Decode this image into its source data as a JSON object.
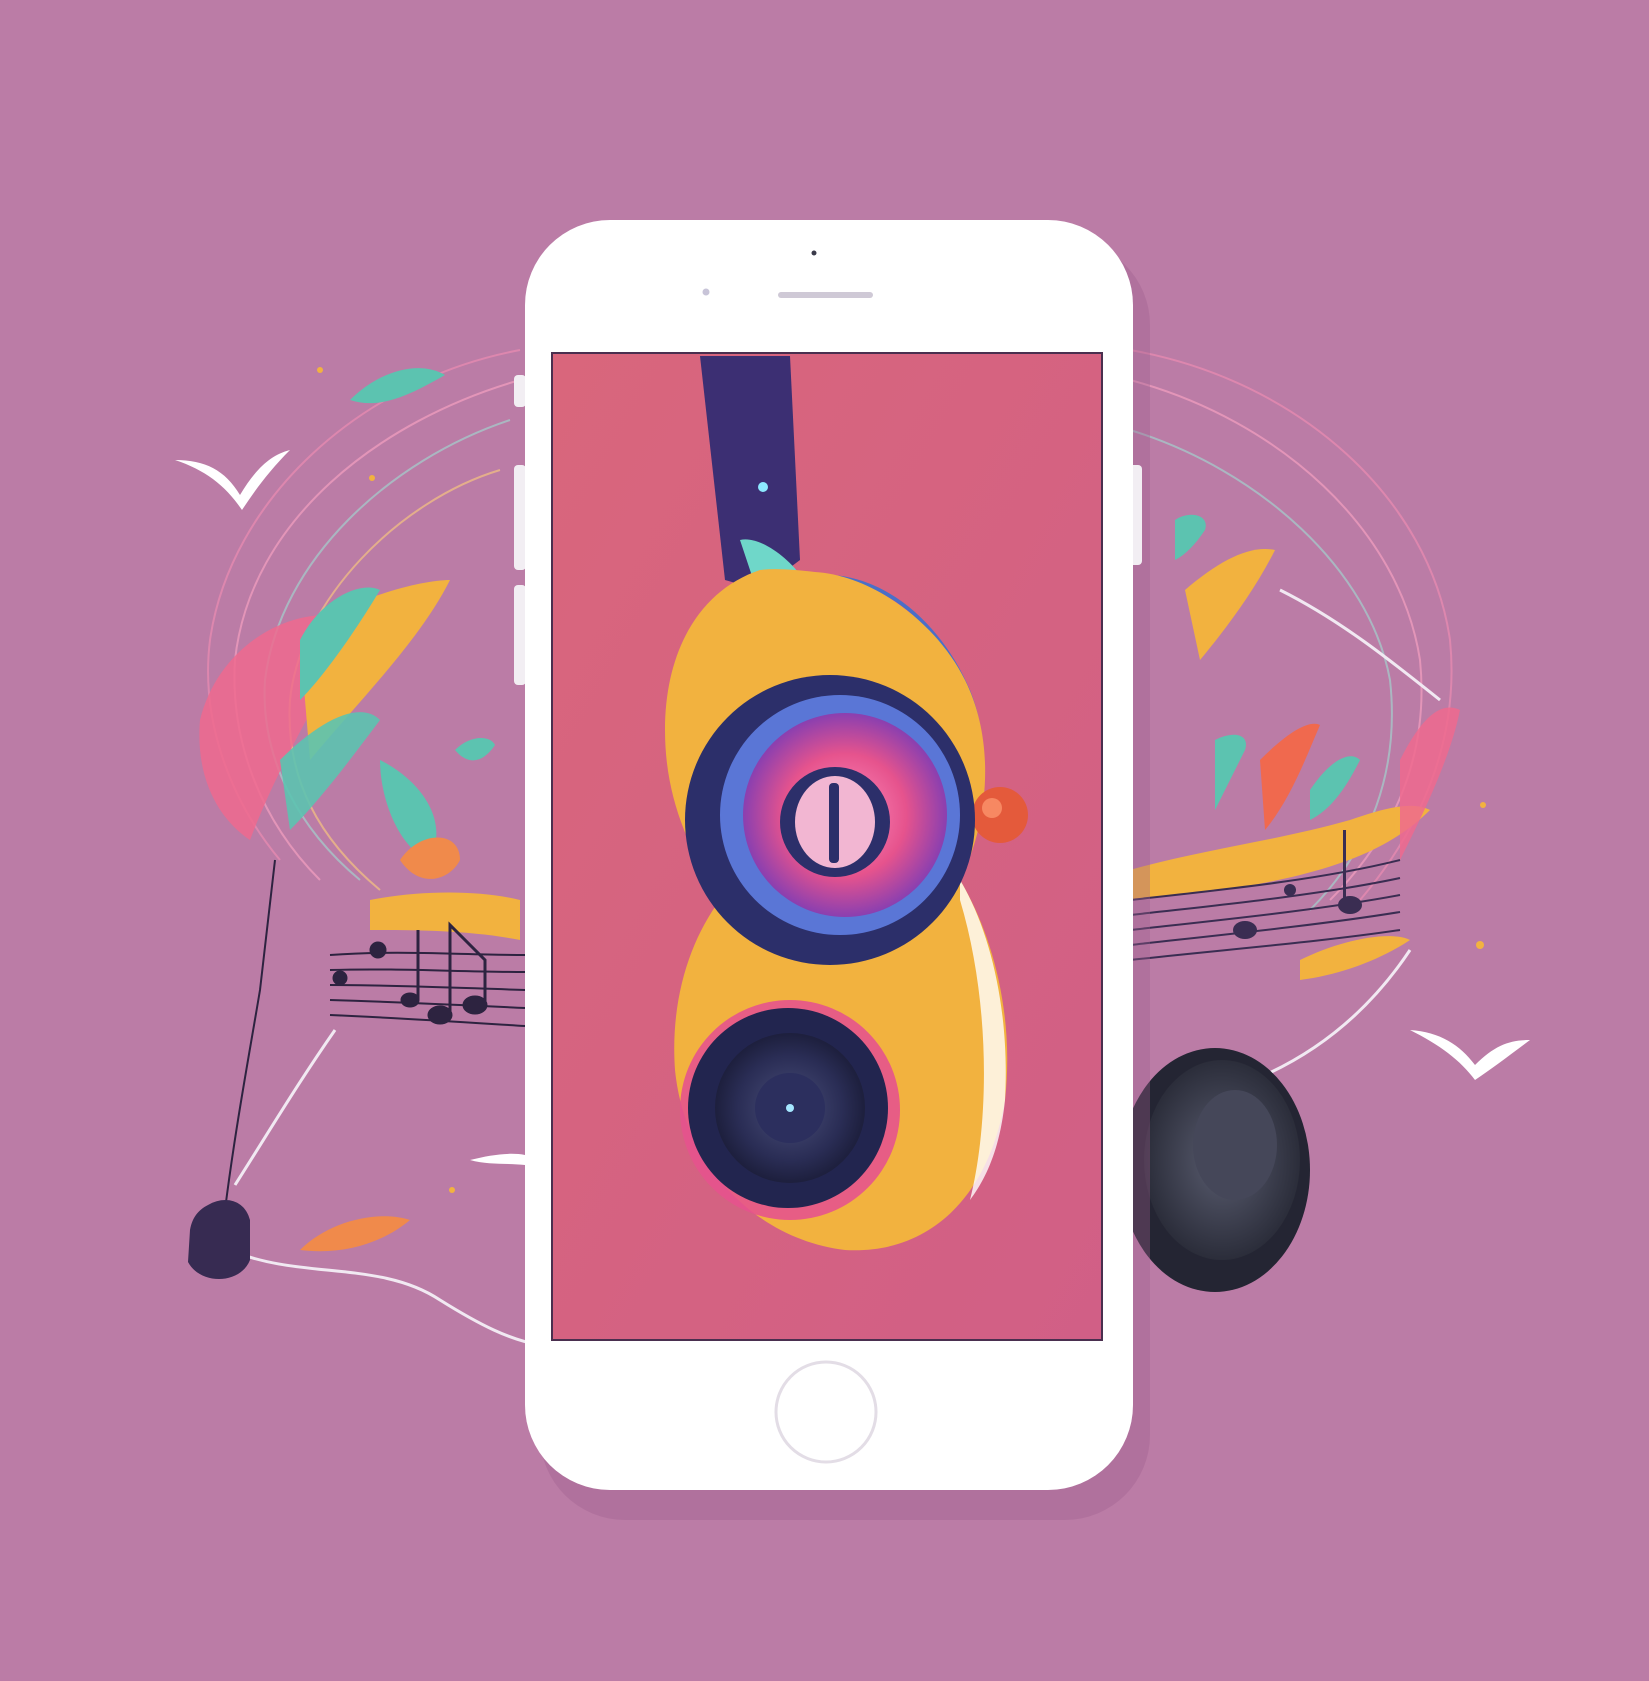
{
  "scene": {
    "background_color": "#bb7ca6",
    "phone_body_color": "#ffffff",
    "screen_color": "#d9657c",
    "headphone_band_color": "#3c2f73",
    "headphone_yellow": "#f2b23f",
    "headphone_pink": "#e6538d",
    "accent_teal": "#5cc3b0",
    "accent_orange": "#f08a4b",
    "earcup_dark": "#2e3046",
    "icons": [
      "phone-icon",
      "headphones-icon",
      "music-note-icon",
      "bird-icon",
      "leaf-icon",
      "earcup-icon",
      "earbud-icon",
      "home-button-icon"
    ]
  }
}
